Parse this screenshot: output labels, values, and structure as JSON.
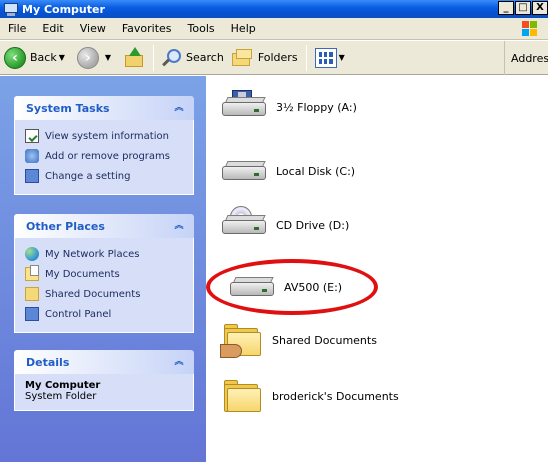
{
  "window": {
    "title": "My Computer",
    "controls": {
      "minimize": "_",
      "maximize": "□",
      "close": "X"
    }
  },
  "menu": [
    "File",
    "Edit",
    "View",
    "Favorites",
    "Tools",
    "Help"
  ],
  "toolbar": {
    "back": "Back",
    "search": "Search",
    "folders": "Folders",
    "address": "Address"
  },
  "system_tasks": {
    "title": "System Tasks",
    "items": [
      "View system information",
      "Add or remove programs",
      "Change a setting"
    ]
  },
  "other_places": {
    "title": "Other Places",
    "items": [
      "My Network Places",
      "My Documents",
      "Shared Documents",
      "Control Panel"
    ]
  },
  "details": {
    "title": "Details",
    "name": "My Computer",
    "type": "System Folder"
  },
  "items": [
    {
      "label": "3½ Floppy (A:)",
      "icon": "floppy-drive-icon"
    },
    {
      "label": "Local Disk (C:)",
      "icon": "hard-disk-icon"
    },
    {
      "label": "CD Drive (D:)",
      "icon": "cd-drive-icon"
    },
    {
      "label": "AV500 (E:)",
      "icon": "removable-drive-icon"
    },
    {
      "label": "Shared Documents",
      "icon": "shared-folder-icon"
    },
    {
      "label": "broderick's Documents",
      "icon": "folder-icon"
    }
  ],
  "colors": {
    "highlight_ring": "#e01010",
    "taskpane_header_text": "#215dc6"
  }
}
